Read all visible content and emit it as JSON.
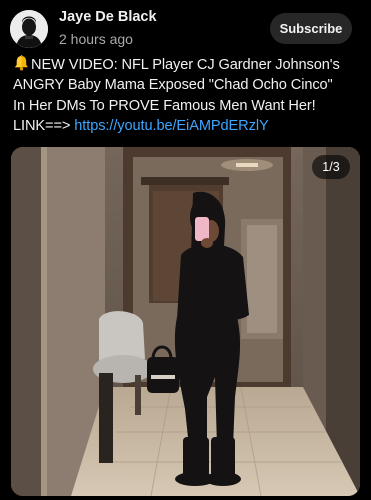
{
  "post": {
    "channel_name": "Jaye De Black",
    "time": "2 hours ago",
    "subscribe_label": "Subscribe",
    "lines": [
      "NEW VIDEO: NFL Player CJ Gardner Johnson's",
      "ANGRY Baby Mama Exposed \"Chad Ocho Cinco\"",
      "In Her DMs To PROVE Famous Men Want Her!",
      "LINK==> "
    ],
    "link": "https://youtu.be/EiAMPdERzlY",
    "bell_icon": "bell-icon",
    "avatar_icon": "avatar-portrait",
    "image_counter": "1/3"
  },
  "colors": {
    "background": "#000000",
    "text": "#f1f1f1",
    "secondary_text": "#aaaaaa",
    "link": "#3ea6ff",
    "subscribe_bg": "#272727"
  }
}
